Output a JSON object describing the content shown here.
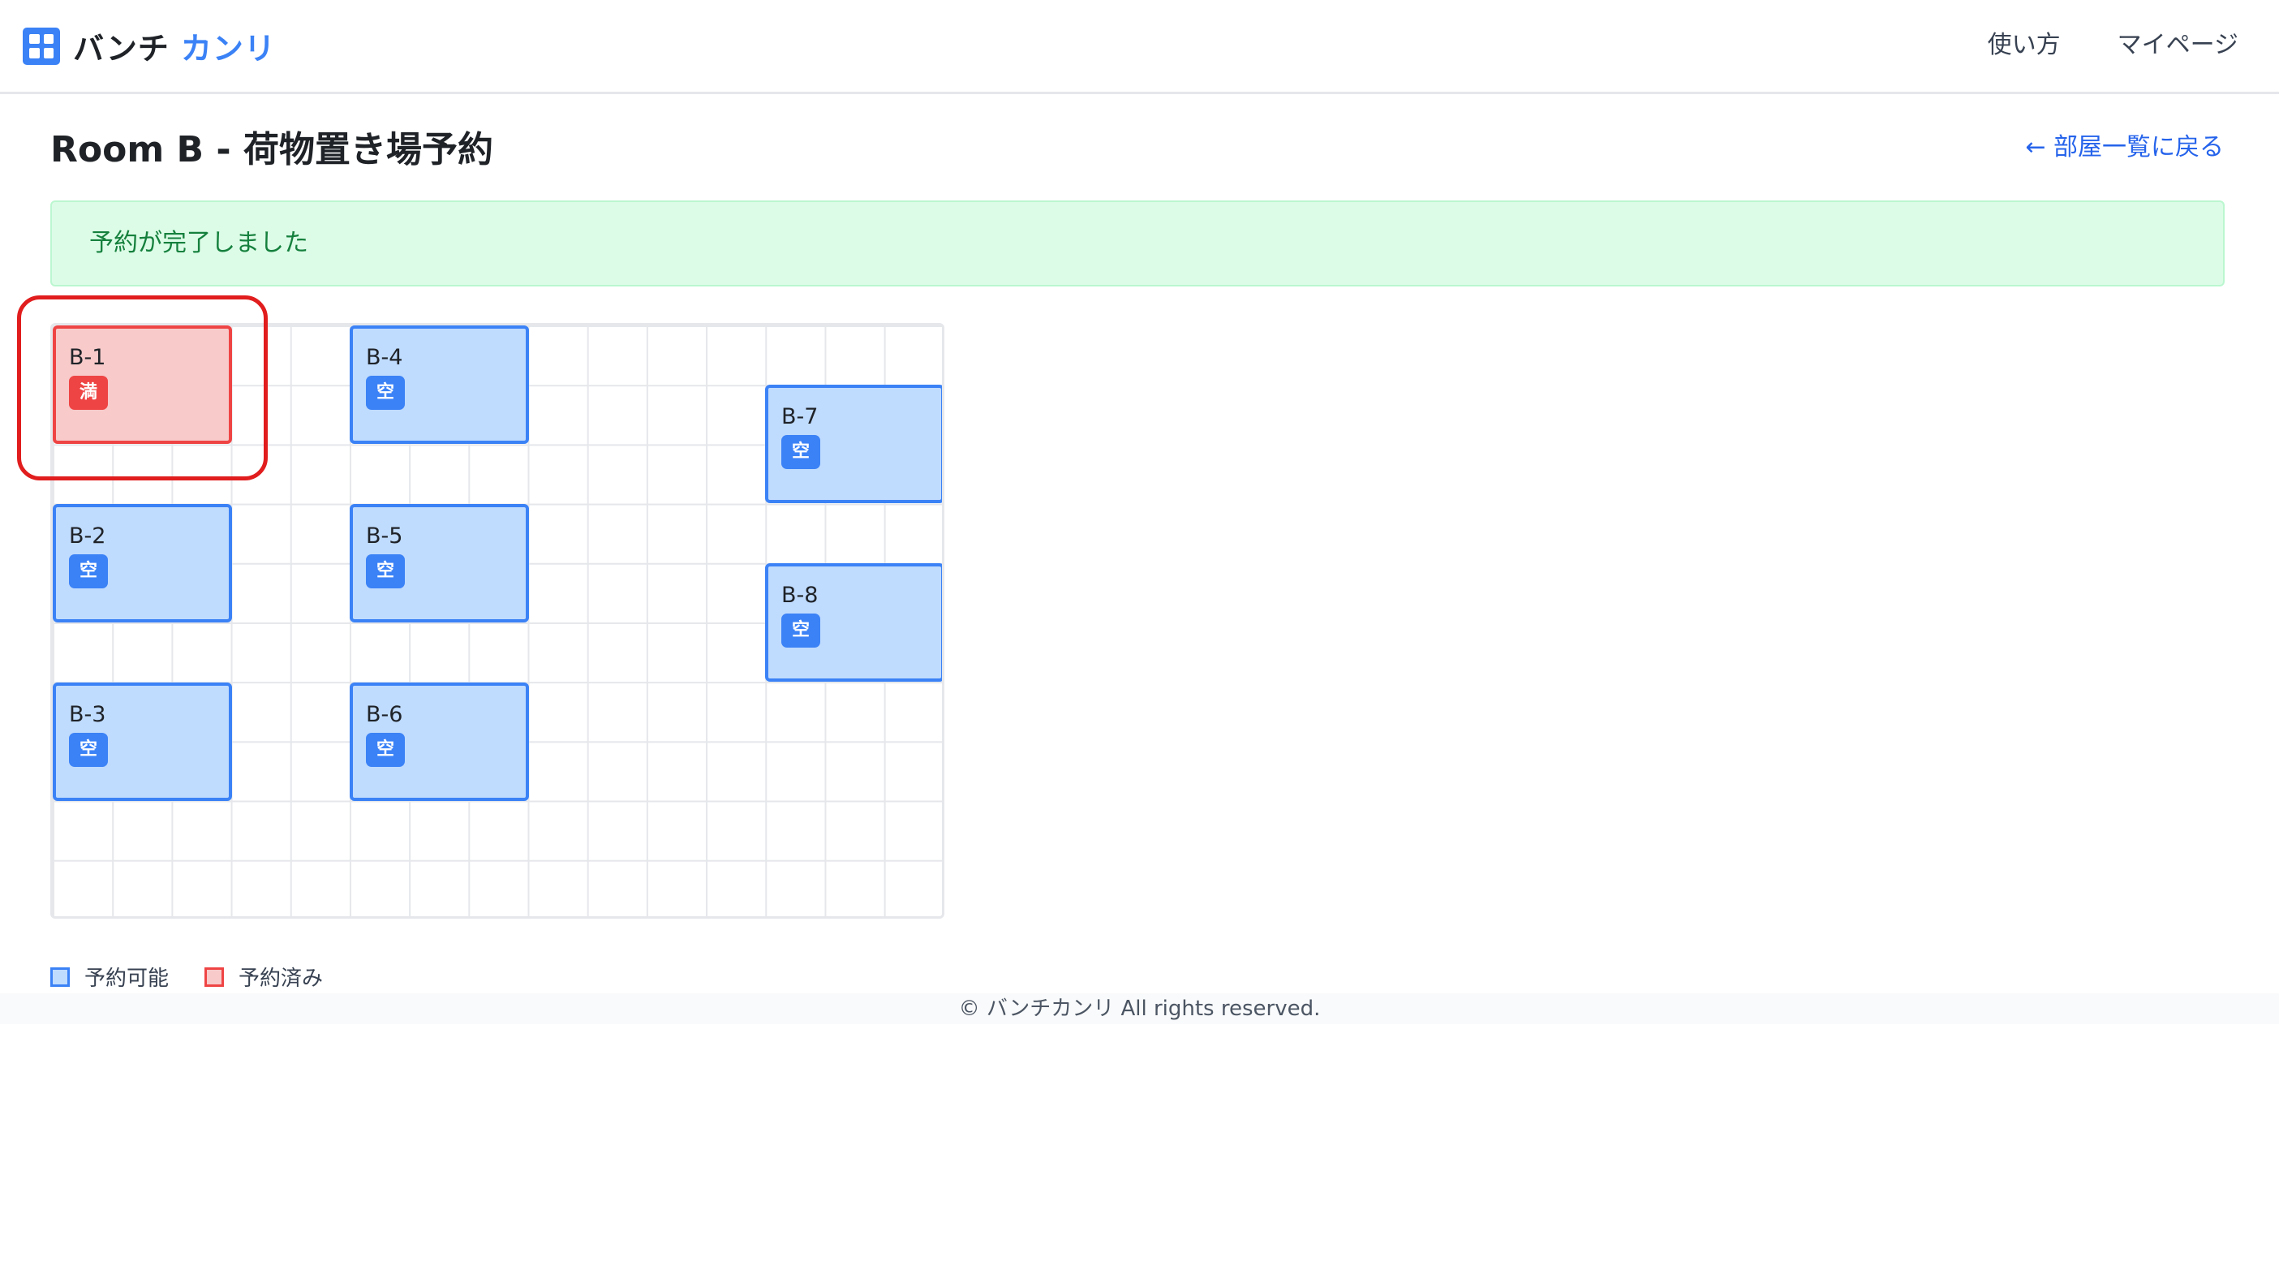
{
  "header": {
    "logo_text_a": "バンチ",
    "logo_text_b": "カンリ",
    "nav": [
      "使い方",
      "マイページ"
    ]
  },
  "page": {
    "title": "Room B - 荷物置き場予約",
    "back_link": "← 部屋一覧に戻る"
  },
  "alert": {
    "message": "予約が完了しました"
  },
  "slots": [
    {
      "label": "B-1",
      "status": "満",
      "state": "full"
    },
    {
      "label": "B-2",
      "status": "空",
      "state": "free"
    },
    {
      "label": "B-3",
      "status": "空",
      "state": "free"
    },
    {
      "label": "B-4",
      "status": "空",
      "state": "free"
    },
    {
      "label": "B-5",
      "status": "空",
      "state": "free"
    },
    {
      "label": "B-6",
      "status": "空",
      "state": "free"
    },
    {
      "label": "B-7",
      "status": "空",
      "state": "free"
    },
    {
      "label": "B-8",
      "status": "空",
      "state": "free"
    }
  ],
  "legend": {
    "free": "予約可能",
    "full": "予約済み"
  },
  "footer": {
    "text": "© バンチカンリ All rights reserved."
  },
  "colors": {
    "accent": "#3b82f6",
    "reserved": "#ef4444",
    "success_bg": "#dcfce7",
    "success_text": "#15803d"
  }
}
